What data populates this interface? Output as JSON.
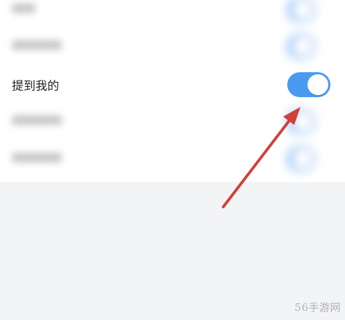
{
  "settings": {
    "rows": [
      {
        "label": "",
        "enabled": true,
        "blurred": true
      },
      {
        "label": "",
        "enabled": true,
        "blurred": true
      },
      {
        "label": "提到我的",
        "enabled": true,
        "blurred": false
      },
      {
        "label": "",
        "enabled": true,
        "blurred": true
      },
      {
        "label": "",
        "enabled": true,
        "blurred": true
      }
    ]
  },
  "colors": {
    "toggle_on": "#4a9af2",
    "arrow": "#d2403a",
    "background": "#f3f4f6"
  },
  "watermark": "56手游网"
}
